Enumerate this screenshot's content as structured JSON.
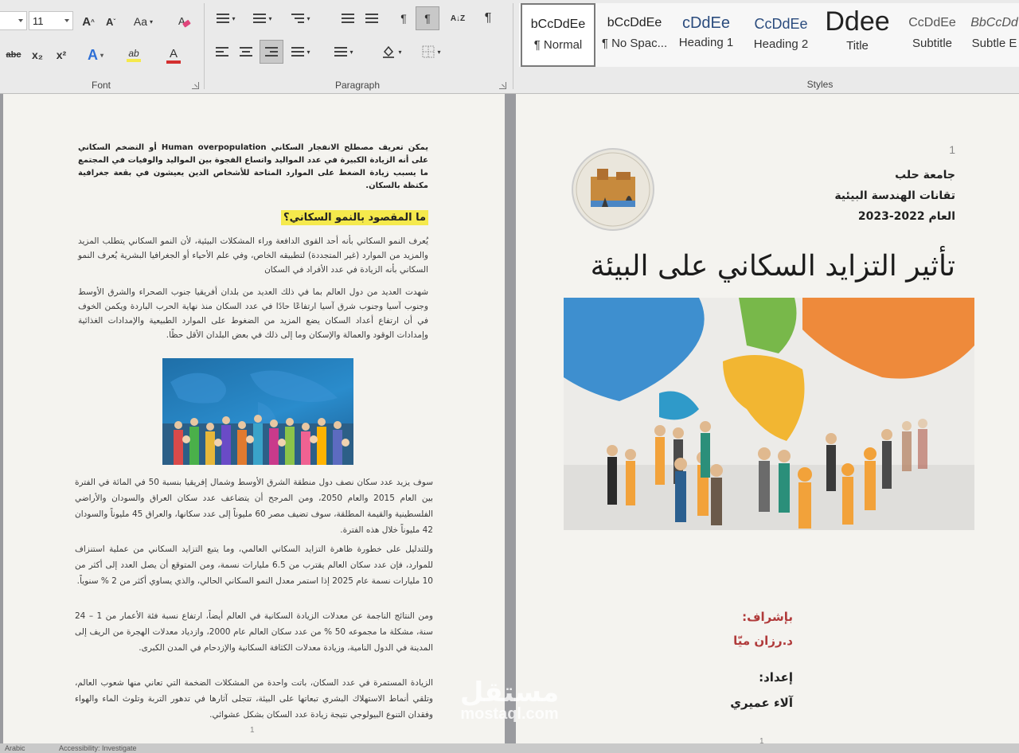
{
  "ribbon": {
    "font_group": {
      "label": "Font",
      "font_size": "11",
      "grow_label": "A",
      "shrink_label": "A",
      "case_label": "Aa",
      "bold_partial": "abc",
      "subscript": "x₂",
      "superscript": "x²",
      "text_effects": "A",
      "highlight": "ab",
      "font_color": "A",
      "highlight_color": "#f5e94c",
      "font_color_value": "#d32f2f"
    },
    "paragraph_group": {
      "label": "Paragraph",
      "sort": "A↓Z",
      "pilcrow": "¶",
      "ltr_mark": "¶",
      "rtl_mark": "¶"
    },
    "styles_group": {
      "label": "Styles",
      "items": [
        {
          "preview": "bCcDdEe",
          "name": "¶ Normal"
        },
        {
          "preview": "bCcDdEe",
          "name": "¶ No Spac..."
        },
        {
          "preview": "cDdEe",
          "name": "Heading 1"
        },
        {
          "preview": "CcDdEe",
          "name": "Heading 2"
        },
        {
          "preview": "Ddee",
          "name": "Title"
        },
        {
          "preview": "CcDdEe",
          "name": "Subtitle"
        },
        {
          "preview": "BbCcDd",
          "name": "Subtle E"
        }
      ]
    }
  },
  "left_page": {
    "intro": "يمكن تعريف مصطلح الانفجار السكاني Human overpopulation أو التضخم السكاني على أنه الزيادة الكبيرة في عدد المواليد واتساع الفجوة بين المواليد والوفيات في المجتمع ما يسبب زيادة الضغط على الموارد المتاحة للأشخاص الذين يعيشون في بقعة جغرافية مكتظة بالسكان.",
    "question": "ما المقصود بالنمو السكاني؟",
    "p1": "يُعرف النمو السكاني بأنه أحد القوى الدافعة وراء المشكلات البيئية، لأن النمو السكاني يتطلب المزيد والمزيد من الموارد (غير المتجددة) لتطبيقه الخاص، وفي علم الأحياء أو الجغرافيا البشرية يُعرف النمو السكاني بأنه الزيادة في عدد الأفراد في السكان",
    "p2": "شهدت العديد من دول العالم بما في ذلك العديد من بلدان أفريقيا جنوب الصحراء والشرق الأوسط وجنوب آسيا وجنوب شرق آسيا ارتفاعًا حادًا في عدد السكان منذ نهاية الحرب الباردة ويكمن الخوف في أن ارتفاع أعداد السكان يضع المزيد من الضغوط على الموارد الطبيعية والإمدادات الغذائية وإمدادات الوقود والعمالة والإسكان وما إلى ذلك في بعض البلدان الأقل حظًا.",
    "p3": "سوف يزيد عدد سكان نصف دول منطقة الشرق الأوسط وشمال إفريقيا بنسبة 50 في المائة في الفترة بين العام 2015 والعام 2050، ومن المرجح أن يتضاعف عدد سكان العراق والسودان والأراضي الفلسطينية والقيمة المطلقة، سوف تضيف مصر 60 مليوناً إلى عدد سكانها، والعراق 45 مليوناً والسودان 42 مليوناً خلال هذه الفترة.",
    "p4": "وللتدليل على خطورة ظاهرة التزايد السكاني العالمي، وما يتبع التزايد السكاني من عملية استنزاف للموارد، فإن عدد سكان العالم يقترب من 6.5 مليارات نسمة، ومن المتوقع أن يصل العدد إلى أكثر من 10 مليارات نسمة عام 2025 إذا استمر معدل النمو السكاني الحالي، والذي يساوي أكثر من 2 % سنوياً.",
    "p5": "ومن النتائج الناجمة عن معدلات الزيادة السكانية في العالم أيضاً، ارتفاع نسبة فئة الأعمار من 1 – 24 سنة، مشكلة ما مجموعه 50 % من عدد سكان العالم عام 2000، وازدياد معدلات الهجرة من الريف إلى المدينة في الدول النامية، وزيادة معدلات الكثافة السكانية والإزدحام في المدن الكبرى.",
    "p6": "الزيادة المستمرة في عدد السكان، باتت واحدة من المشكلات الضخمة التي تعاني منها شعوب العالم، وتلقي أنماط الاستهلاك البشري تبعاتها على البيئة، تتجلى آثارها في تدهور التربة وتلوث الماء والهواء وفقدان التنوع البيولوجي نتيجة زيادة عدد السكان بشكل عشوائي.",
    "page_number": "1"
  },
  "right_page": {
    "page_number": "1",
    "university": "جامعة حلب",
    "course": "تقانات الهندسة البيئية",
    "year": "العام 2022-2023",
    "title": "تأثير التزايد السكاني على البيئة",
    "supervision_label": "بإشراف:",
    "supervisor": "د.رزان ميّا",
    "prepared_label": "إعداد:",
    "author": "آلاء عميري",
    "bottom_number": "1"
  },
  "watermark": {
    "arabic": "مستقل",
    "latin": "mostaql.com"
  },
  "status": {
    "language": "Arabic",
    "accessibility": "Accessibility: Investigate"
  },
  "colors": {
    "highlight": "#f5e94c",
    "supervisor_text": "#b03a3a",
    "ribbon_bg": "#eaeaea",
    "page_bg": "#f4f3ef"
  }
}
